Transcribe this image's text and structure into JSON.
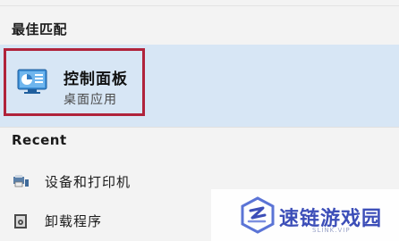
{
  "search_results": {
    "best_match_heading": "最佳匹配",
    "best_match": {
      "title": "控制面板",
      "subtitle": "桌面应用",
      "icon": "control-panel-icon"
    },
    "recent_heading": "Recent",
    "recent_items": [
      {
        "label": "设备和打印机",
        "icon": "devices-printers-icon"
      },
      {
        "label": "卸载程序",
        "icon": "uninstall-program-icon"
      }
    ]
  },
  "watermark": {
    "title": "速链游戏园",
    "subtitle": "SLINK.VIP"
  },
  "colors": {
    "highlight_border": "#b0233b",
    "selected_background": "#d7e6f5",
    "watermark_text": "#3c4eb8"
  }
}
